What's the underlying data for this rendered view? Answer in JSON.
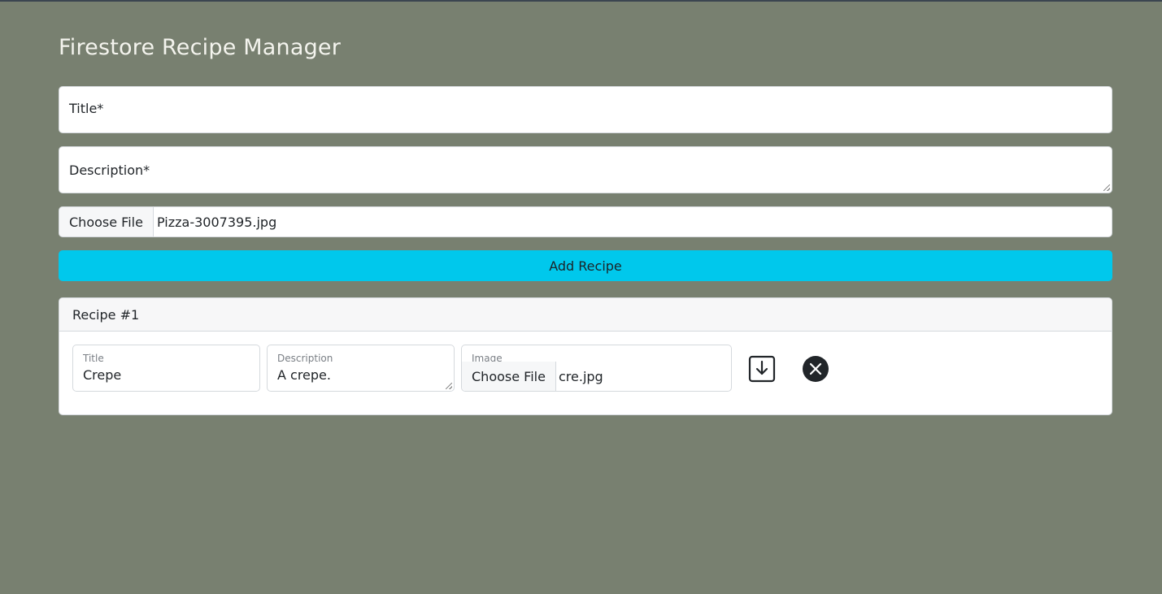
{
  "page_title": "Firestore Recipe Manager",
  "form": {
    "title_placeholder": "Title*",
    "description_placeholder": "Description*",
    "file_button_label": "Choose File",
    "file_name": "Pizza-3007395.jpg",
    "add_button_label": "Add Recipe"
  },
  "recipes": [
    {
      "header": "Recipe #1",
      "title_label": "Title",
      "title_value": "Crepe",
      "description_label": "Description",
      "description_value": "A crepe.",
      "image_label": "Image",
      "file_button_label": "Choose File",
      "file_name": "cre.jpg",
      "save_icon": "download-box-icon",
      "delete_icon": "close-circle-icon"
    }
  ],
  "colors": {
    "background": "#788070",
    "accent_button": "#00c8ec",
    "title_text": "#f4f4ee"
  }
}
